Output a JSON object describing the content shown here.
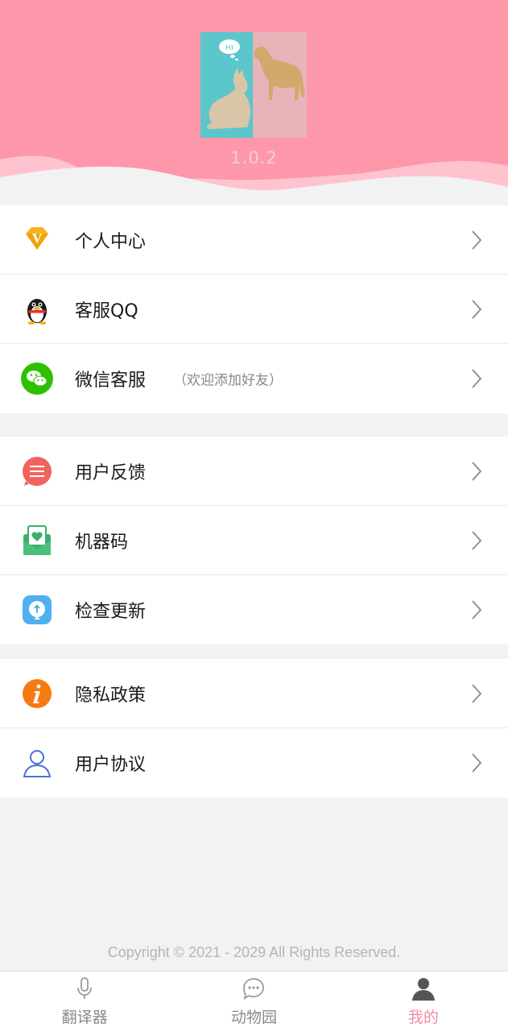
{
  "app": {
    "version": "1.0.2"
  },
  "menu_group_1": [
    {
      "label": "个人中心",
      "sub": "",
      "icon": "vip-diamond-icon"
    },
    {
      "label": "客服QQ",
      "sub": "",
      "icon": "qq-penguin-icon"
    },
    {
      "label": "微信客服",
      "sub": "（欢迎添加好友）",
      "icon": "wechat-icon"
    }
  ],
  "menu_group_2": [
    {
      "label": "用户反馈",
      "icon": "feedback-icon"
    },
    {
      "label": "机器码",
      "icon": "machine-code-icon"
    },
    {
      "label": "检查更新",
      "icon": "update-icon"
    }
  ],
  "menu_group_3": [
    {
      "label": "隐私政策",
      "icon": "info-icon"
    },
    {
      "label": "用户协议",
      "icon": "user-icon"
    }
  ],
  "footer": {
    "copyright": "Copyright © 2021 - 2029 All Rights Reserved."
  },
  "tabbar": [
    {
      "label": "翻译器",
      "icon": "microphone-icon",
      "active": false
    },
    {
      "label": "动物园",
      "icon": "chat-bubble-icon",
      "active": false
    },
    {
      "label": "我的",
      "icon": "person-icon",
      "active": true
    }
  ],
  "colors": {
    "header_bg": "#ff97ab",
    "accent": "#f58aa3",
    "page_bg": "#f2f2f2"
  }
}
